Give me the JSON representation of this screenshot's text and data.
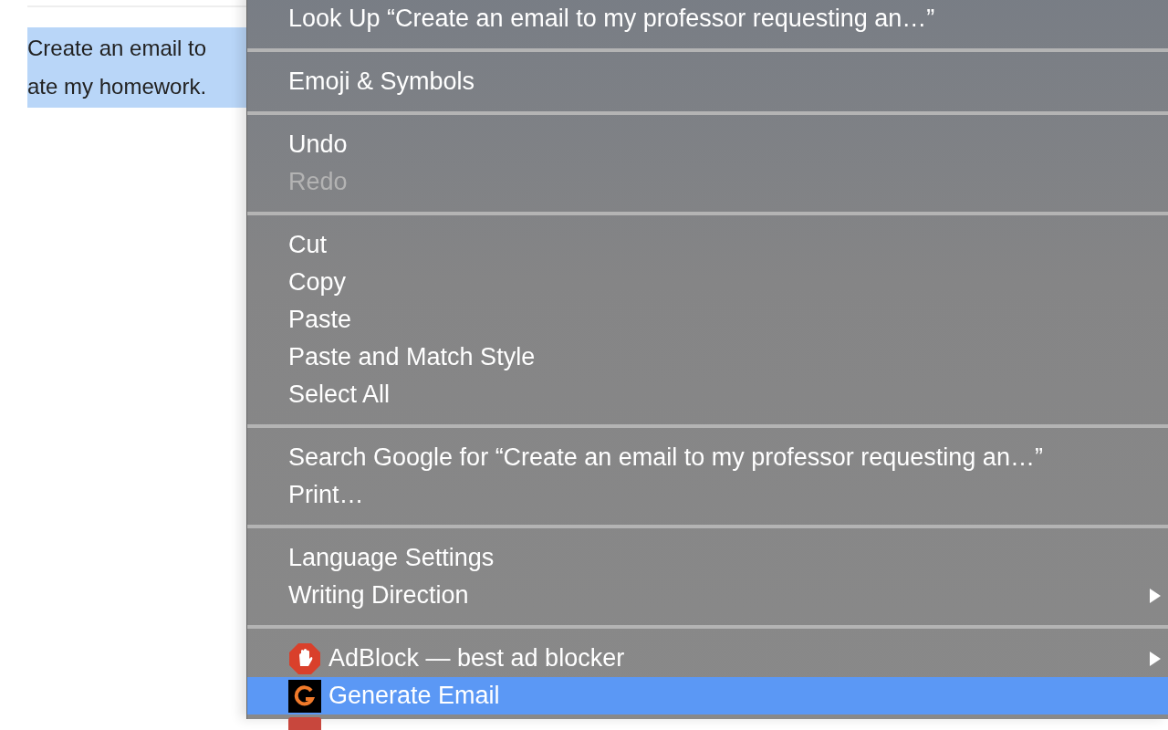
{
  "document": {
    "lines": [
      "Create an email to",
      "ate my homework."
    ],
    "selected": true
  },
  "context_menu": {
    "groups": [
      {
        "items": [
          {
            "kind": "plain",
            "label": "Look Up “Create an email to my professor requesting an…”",
            "disabled": false,
            "selected": false,
            "submenu": false
          }
        ]
      },
      {
        "items": [
          {
            "kind": "plain",
            "label": "Emoji & Symbols",
            "disabled": false,
            "selected": false,
            "submenu": false
          }
        ]
      },
      {
        "items": [
          {
            "kind": "plain",
            "label": "Undo",
            "disabled": false,
            "selected": false,
            "submenu": false
          },
          {
            "kind": "plain",
            "label": "Redo",
            "disabled": true,
            "selected": false,
            "submenu": false
          }
        ]
      },
      {
        "items": [
          {
            "kind": "plain",
            "label": "Cut",
            "disabled": false,
            "selected": false,
            "submenu": false
          },
          {
            "kind": "plain",
            "label": "Copy",
            "disabled": false,
            "selected": false,
            "submenu": false
          },
          {
            "kind": "plain",
            "label": "Paste",
            "disabled": false,
            "selected": false,
            "submenu": false
          },
          {
            "kind": "plain",
            "label": "Paste and Match Style",
            "disabled": false,
            "selected": false,
            "submenu": false
          },
          {
            "kind": "plain",
            "label": "Select All",
            "disabled": false,
            "selected": false,
            "submenu": false
          }
        ]
      },
      {
        "items": [
          {
            "kind": "plain",
            "label": "Search Google for “Create an email to my professor requesting an…”",
            "disabled": false,
            "selected": false,
            "submenu": false
          },
          {
            "kind": "plain",
            "label": "Print…",
            "disabled": false,
            "selected": false,
            "submenu": false
          }
        ]
      },
      {
        "items": [
          {
            "kind": "plain",
            "label": "Language Settings",
            "disabled": false,
            "selected": false,
            "submenu": false
          },
          {
            "kind": "plain",
            "label": "Writing Direction",
            "disabled": false,
            "selected": false,
            "submenu": true
          }
        ]
      },
      {
        "items": [
          {
            "kind": "adblock",
            "label": "AdBlock — best ad blocker",
            "disabled": false,
            "selected": false,
            "submenu": true
          },
          {
            "kind": "generate",
            "label": "Generate Email",
            "disabled": false,
            "selected": true,
            "submenu": false
          },
          {
            "kind": "lastpass",
            "selected": false
          }
        ]
      }
    ]
  }
}
